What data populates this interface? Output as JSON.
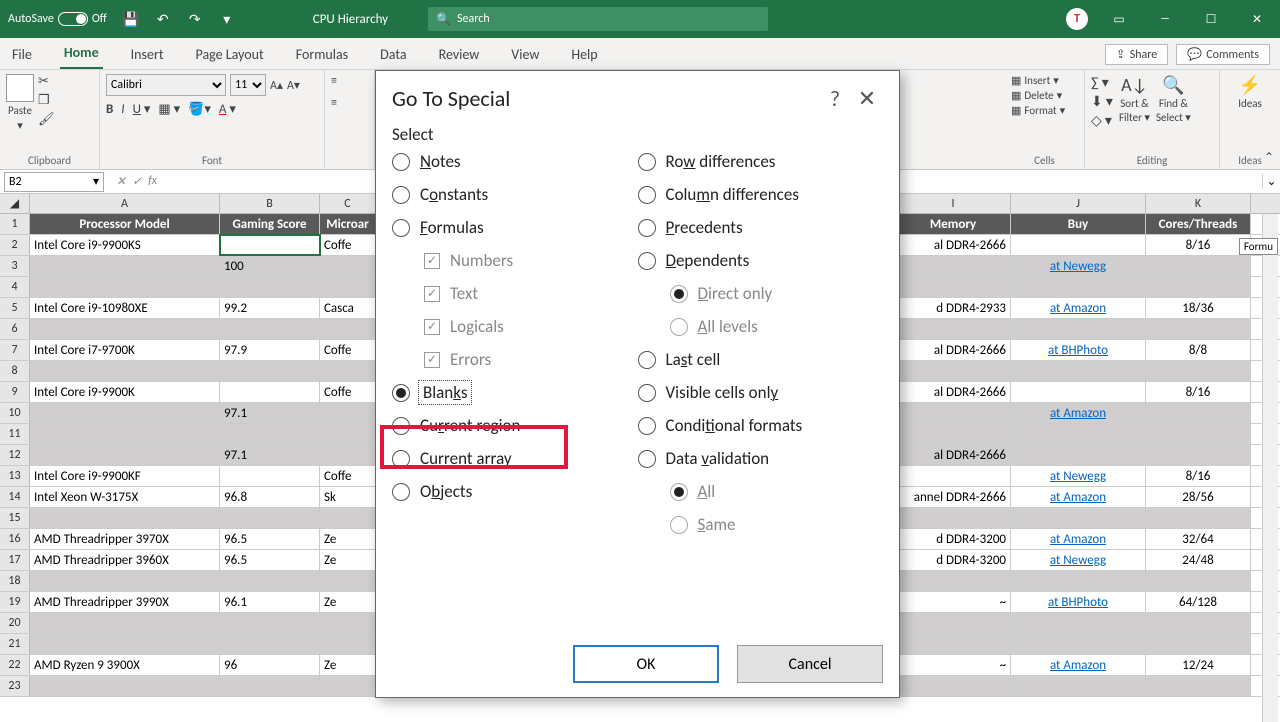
{
  "titlebar": {
    "autosave_label": "AutoSave",
    "autosave_state": "Off",
    "doc_title": "CPU Hierarchy",
    "search_placeholder": "Search",
    "avatar_initial": "T"
  },
  "tabs": {
    "items": [
      "File",
      "Home",
      "Insert",
      "Page Layout",
      "Formulas",
      "Data",
      "Review",
      "View",
      "Help"
    ],
    "active": "Home",
    "share": "Share",
    "comments": "Comments"
  },
  "ribbon": {
    "clipboard": {
      "label": "Clipboard",
      "paste": "Paste"
    },
    "font": {
      "label": "Font",
      "name": "Calibri",
      "size": "11"
    },
    "cells": {
      "label": "Cells",
      "insert": "Insert",
      "delete": "Delete",
      "format": "Format"
    },
    "editing": {
      "label": "Editing",
      "sort": "Sort &",
      "filter": "Filter",
      "find": "Find &",
      "select": "Select"
    },
    "ideas": {
      "label": "Ideas",
      "btn": "Ideas"
    }
  },
  "fxbar": {
    "namebox": "B2",
    "fx": "fx"
  },
  "colheads": [
    "A",
    "B",
    "C",
    "I",
    "J",
    "K"
  ],
  "header_row": {
    "A": "Processor Model",
    "B": "Gaming Score",
    "C": "Microar",
    "I": "Memory",
    "J": "Buy",
    "K": "Cores/Threads"
  },
  "rows": [
    {
      "n": 1,
      "hdr": true
    },
    {
      "n": 2,
      "A": "Intel Core i9-9900KS",
      "B": "",
      "C": "Coffe",
      "I": "al DDR4-2666",
      "J": "",
      "K": "8/16",
      "sel": true
    },
    {
      "n": 3,
      "A": "",
      "B": "100",
      "C": "",
      "I": "",
      "J": "at Newegg",
      "K": "",
      "grey": true
    },
    {
      "n": 4,
      "empty": true,
      "grey": true
    },
    {
      "n": 5,
      "A": "Intel Core i9-10980XE",
      "B": "99.2",
      "C": "Casca",
      "I": "d DDR4-2933",
      "J": "at Amazon",
      "K": "18/36"
    },
    {
      "n": 6,
      "empty": true,
      "grey": true
    },
    {
      "n": 7,
      "A": "Intel Core i7-9700K",
      "B": "97.9",
      "C": "Coffe",
      "I": "al DDR4-2666",
      "J": "at BHPhoto",
      "K": "8/8"
    },
    {
      "n": 8,
      "empty": true,
      "grey": true
    },
    {
      "n": 9,
      "A": "Intel Core i9-9900K",
      "B": "",
      "C": "Coffe",
      "I": "al DDR4-2666",
      "J": "",
      "K": "8/16"
    },
    {
      "n": 10,
      "A": "",
      "B": "97.1",
      "C": "",
      "I": "",
      "J": "at Amazon",
      "K": "",
      "grey": true
    },
    {
      "n": 11,
      "empty": true,
      "grey": true
    },
    {
      "n": 12,
      "A": "",
      "B": "97.1",
      "C": "",
      "I": "al DDR4-2666",
      "J": "",
      "K": "",
      "grey": true
    },
    {
      "n": 13,
      "A": "Intel Core i9-9900KF",
      "B": "",
      "C": "Coffe",
      "I": "",
      "J": "at Newegg",
      "K": "8/16"
    },
    {
      "n": 14,
      "A": "Intel Xeon W-3175X",
      "B": "96.8",
      "C": "Sk",
      "I": "annel DDR4-2666",
      "J": "at Amazon",
      "K": "28/56"
    },
    {
      "n": 15,
      "empty": true,
      "grey": true
    },
    {
      "n": 16,
      "A": "AMD Threadripper 3970X",
      "B": "96.5",
      "C": "Ze",
      "I": "d DDR4-3200",
      "J": "at Amazon",
      "K": "32/64"
    },
    {
      "n": 17,
      "A": "AMD Threadripper 3960X",
      "B": "96.5",
      "C": "Ze",
      "I": "d DDR4-3200",
      "J": "at Newegg",
      "K": "24/48"
    },
    {
      "n": 18,
      "empty": true,
      "grey": true
    },
    {
      "n": 19,
      "A": "AMD Threadripper 3990X",
      "B": "96.1",
      "C": "Ze",
      "I": "~",
      "J": "at BHPhoto",
      "K": "64/128"
    },
    {
      "n": 20,
      "empty": true,
      "grey": true
    },
    {
      "n": 21,
      "empty": true,
      "grey": true
    },
    {
      "n": 22,
      "A": "AMD Ryzen 9 3900X",
      "B": "96",
      "C": "Ze",
      "I": "~",
      "J": "at Amazon",
      "K": "12/24"
    },
    {
      "n": 23,
      "empty": true,
      "grey": true
    }
  ],
  "tooltip": "Formu",
  "dialog": {
    "title": "Go To Special",
    "section": "Select",
    "left": [
      {
        "key": "notes",
        "label": "Notes",
        "u": "N"
      },
      {
        "key": "constants",
        "label": "Constants",
        "u": "o"
      },
      {
        "key": "formulas",
        "label": "Formulas",
        "u": "F"
      },
      {
        "key": "blanks",
        "label": "Blanks",
        "u": "k",
        "selected": true
      },
      {
        "key": "current-region",
        "label": "Current region",
        "u": "r"
      },
      {
        "key": "current-array",
        "label": "Current array",
        "u": "a"
      },
      {
        "key": "objects",
        "label": "Objects",
        "u": "b"
      }
    ],
    "formula_checks": [
      "Numbers",
      "Text",
      "Logicals",
      "Errors"
    ],
    "right": [
      {
        "key": "row-diff",
        "label": "Row differences",
        "u": "w"
      },
      {
        "key": "col-diff",
        "label": "Column differences",
        "u": "m"
      },
      {
        "key": "precedents",
        "label": "Precedents",
        "u": "P"
      },
      {
        "key": "dependents",
        "label": "Dependents",
        "u": "D"
      },
      {
        "key": "last-cell",
        "label": "Last cell",
        "u": "s"
      },
      {
        "key": "visible",
        "label": "Visible cells only",
        "u": "y"
      },
      {
        "key": "cond-fmt",
        "label": "Conditional formats",
        "u": "t"
      },
      {
        "key": "data-val",
        "label": "Data validation",
        "u": "v"
      }
    ],
    "dep_subs": [
      "Direct only",
      "All levels"
    ],
    "val_subs": [
      "All",
      "Same"
    ],
    "ok": "OK",
    "cancel": "Cancel"
  }
}
